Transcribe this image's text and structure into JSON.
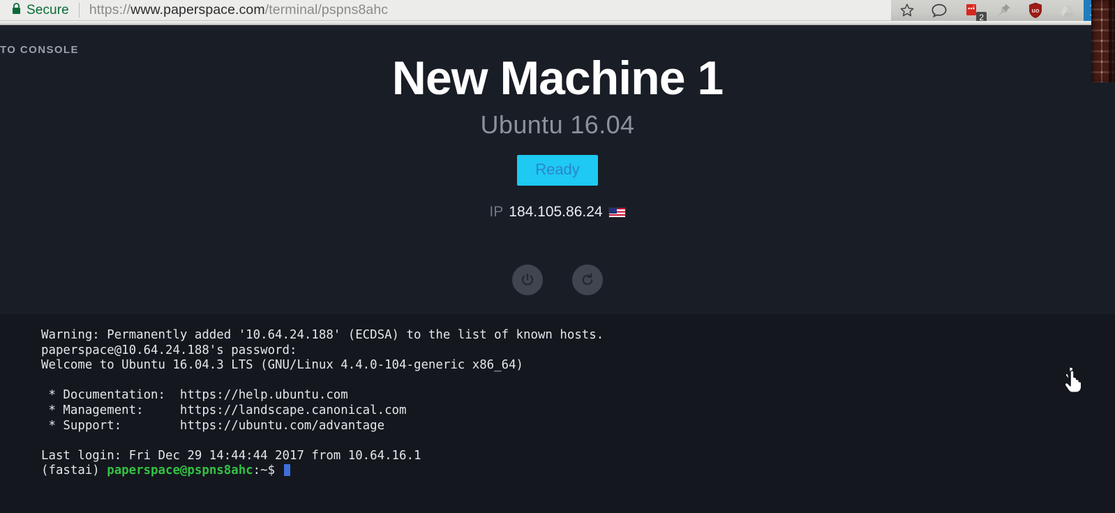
{
  "browser": {
    "security_label": "Secure",
    "url_scheme": "https://",
    "url_host": "www.paperspace.com",
    "url_path": "/terminal/pspns8ahc",
    "url_full": "https://www.paperspace.com/terminal/pspns8ahc",
    "toolbar": [
      {
        "name": "bookmark-star-icon",
        "label": "Bookmark this page"
      },
      {
        "name": "speech-bubble-icon",
        "label": "Comment"
      },
      {
        "name": "red-extension-icon",
        "label": "Extension",
        "badge": "2"
      },
      {
        "name": "pushpin-icon",
        "label": "Pin"
      },
      {
        "name": "ublock-shield-icon",
        "label": "uBlock Origin"
      },
      {
        "name": "google-drive-icon",
        "label": "Save to Google Drive"
      },
      {
        "name": "r-extension-icon",
        "label": "R"
      }
    ]
  },
  "page": {
    "back_link": "TO CONSOLE",
    "machine": {
      "title": "New Machine 1",
      "os": "Ubuntu 16.04",
      "status": "Ready",
      "ip_label": "IP",
      "ip_value": "184.105.86.24",
      "region_flag": "us-flag"
    },
    "controls": [
      {
        "name": "power-button",
        "label": "Power"
      },
      {
        "name": "restart-button",
        "label": "Restart"
      }
    ],
    "colors": {
      "accent": "#1ec9f2",
      "accent_text": "#2c86c8",
      "page_bg": "#191d25",
      "terminal_bg": "#14171e",
      "prompt_green": "#35c043",
      "cursor_blue": "#3f6fd8",
      "secure_green": "#0a6b37"
    }
  },
  "terminal": {
    "lines": [
      {
        "segments": [
          {
            "text": "Warning: Permanently added '10.64.24.188' (ECDSA) to the list of known hosts.",
            "color": "default"
          }
        ]
      },
      {
        "segments": [
          {
            "text": "paperspace@10.64.24.188's password:",
            "color": "default"
          }
        ]
      },
      {
        "segments": [
          {
            "text": "Welcome to Ubuntu 16.04.3 LTS (GNU/Linux 4.4.0-104-generic x86_64)",
            "color": "default"
          }
        ]
      },
      {
        "segments": [
          {
            "text": "",
            "color": "default"
          }
        ]
      },
      {
        "segments": [
          {
            "text": " * Documentation:  https://help.ubuntu.com",
            "color": "default"
          }
        ]
      },
      {
        "segments": [
          {
            "text": " * Management:     https://landscape.canonical.com",
            "color": "default"
          }
        ]
      },
      {
        "segments": [
          {
            "text": " * Support:        https://ubuntu.com/advantage",
            "color": "default"
          }
        ]
      },
      {
        "segments": [
          {
            "text": "",
            "color": "default"
          }
        ]
      },
      {
        "segments": [
          {
            "text": "Last login: Fri Dec 29 14:44:44 2017 from 10.64.16.1",
            "color": "default"
          }
        ]
      },
      {
        "segments": [
          {
            "text": "(fastai) ",
            "color": "default"
          },
          {
            "text": "paperspace@pspns8ahc",
            "color": "green"
          },
          {
            "text": ":~$ ",
            "color": "default"
          },
          {
            "text": "",
            "color": "cursor"
          }
        ]
      }
    ]
  }
}
